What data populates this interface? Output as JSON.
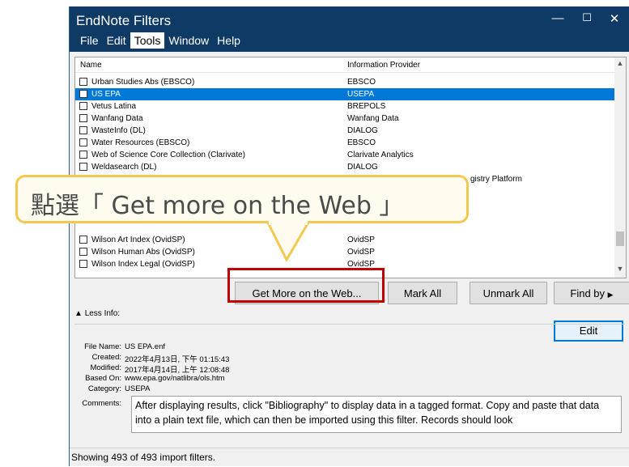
{
  "window": {
    "title": "EndNote Filters",
    "controls": {
      "minimize": "—",
      "maximize": "☐",
      "close": "✕"
    }
  },
  "menu": [
    "File",
    "Edit",
    "Tools",
    "Window",
    "Help"
  ],
  "list": {
    "headers": {
      "name": "Name",
      "provider": "Information Provider"
    },
    "rows": [
      {
        "name": "Urban Studies Abs (EBSCO)",
        "provider": "EBSCO",
        "selected": false
      },
      {
        "name": "US EPA",
        "provider": "USEPA",
        "selected": true
      },
      {
        "name": "Vetus Latina",
        "provider": "BREPOLS",
        "selected": false
      },
      {
        "name": "Wanfang Data",
        "provider": "Wanfang Data",
        "selected": false
      },
      {
        "name": "WasteInfo (DL)",
        "provider": "DIALOG",
        "selected": false
      },
      {
        "name": "Water Resources (EBSCO)",
        "provider": "EBSCO",
        "selected": false
      },
      {
        "name": "Web of Science Core Collection (Clarivate)",
        "provider": "Clarivate Analytics",
        "selected": false
      },
      {
        "name": "Weldasearch (DL)",
        "provider": "DIALOG",
        "selected": false
      },
      {
        "name": "",
        "provider": "gistry Platform",
        "selected": false
      },
      {
        "name": "Wilson Art Index (OvidSP)",
        "provider": "OvidSP",
        "selected": false
      },
      {
        "name": "Wilson Human Abs (OvidSP)",
        "provider": "OvidSP",
        "selected": false
      },
      {
        "name": "Wilson Index Legal (OvidSP)",
        "provider": "OvidSP",
        "selected": false
      }
    ]
  },
  "buttons": {
    "get_more": "Get More on the Web...",
    "mark_all": "Mark All",
    "unmark_all": "Unmark All",
    "find_by": "Find by"
  },
  "less_info": "Less Info:",
  "edit": "Edit",
  "details": {
    "file_name_label": "File Name:",
    "file_name": "US EPA.enf",
    "created_label": "Created:",
    "created": "2022年4月13日, 下午 01:15:43",
    "modified_label": "Modified:",
    "modified": "2017年4月14日, 上午 12:08:48",
    "based_on_label": "Based On:",
    "based_on": "www.epa.gov/natlibra/ols.htm",
    "category_label": "Category:",
    "category": "USEPA",
    "comments_label": "Comments:",
    "comments": "After displaying results, click \"Bibliography\" to display data in a tagged format.  Copy and paste that data into a plain text file, which can then be imported using this filter.  Records should look"
  },
  "status": "Showing 493 of 493 import filters.",
  "callout": "點選「 Get more on the Web 」",
  "colors": {
    "titlebar": "#0f3a66",
    "selection": "#0078d7",
    "callout_border": "#f1c94e",
    "highlight": "#c00000"
  }
}
